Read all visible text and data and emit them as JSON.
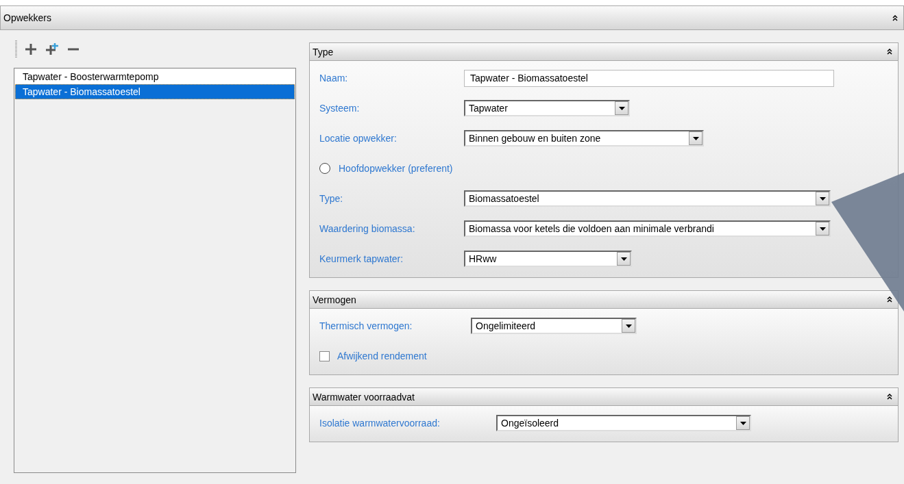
{
  "header": {
    "title": "Opwekkers"
  },
  "list": [
    {
      "label": "Tapwater - Boosterwarmtepomp",
      "selected": false
    },
    {
      "label": "Tapwater - Biomassatoestel",
      "selected": true
    }
  ],
  "panels": [
    {
      "title": "Type",
      "rows": [
        {
          "kind": "text",
          "label": "Naam:",
          "value": "Tapwater - Biomassatoestel"
        },
        {
          "kind": "dropdown",
          "label": "Systeem:",
          "value": "Tapwater"
        },
        {
          "kind": "dropdown",
          "label": "Locatie opwekker:",
          "value": "Binnen gebouw en buiten zone"
        },
        {
          "kind": "radio",
          "label": "Hoofdopwekker (preferent)",
          "checked": false
        },
        {
          "kind": "dropdown",
          "label": "Type:",
          "value": "Biomassatoestel"
        },
        {
          "kind": "dropdown",
          "label": "Waardering biomassa:",
          "value": "Biomassa voor ketels die voldoen aan minimale verbrandi"
        },
        {
          "kind": "dropdown",
          "label": "Keurmerk tapwater:",
          "value": "HRww"
        }
      ]
    },
    {
      "title": "Vermogen",
      "rows": [
        {
          "kind": "dropdown",
          "label": "Thermisch vermogen:",
          "value": "Ongelimiteerd"
        },
        {
          "kind": "checkbox",
          "label": "Afwijkend rendement",
          "checked": false
        }
      ]
    },
    {
      "title": "Warmwater voorraadvat",
      "rows": [
        {
          "kind": "dropdown",
          "label": "Isolatie warmwatervoorraad:",
          "value": "Ongeïsoleerd"
        }
      ]
    }
  ]
}
